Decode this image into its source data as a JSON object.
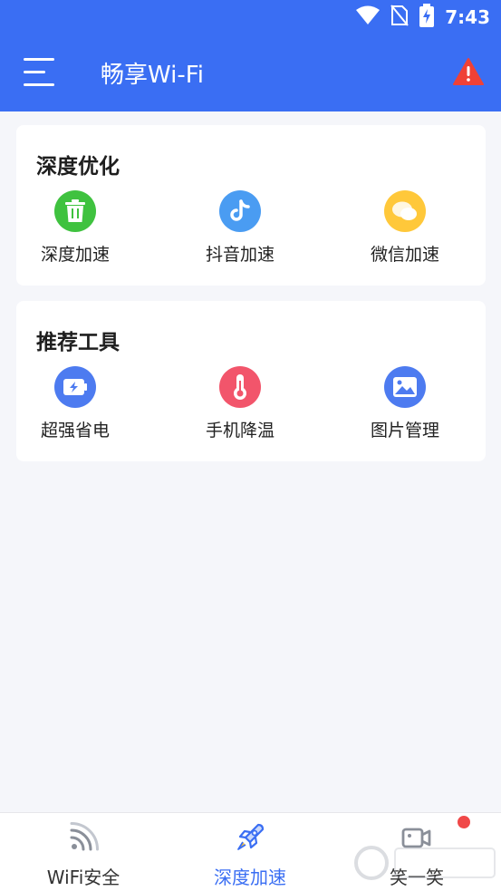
{
  "status_bar": {
    "time": "7:43",
    "icons": [
      "wifi-icon",
      "no-sim-icon",
      "battery-charging-icon"
    ]
  },
  "header": {
    "title": "畅享Wi-Fi",
    "menu_icon": "hamburger-menu-icon",
    "alert_icon": "warning-triangle-icon",
    "background_color": "#3a6ef3",
    "alert_color": "#ef4136"
  },
  "sections": [
    {
      "title": "深度优化",
      "items": [
        {
          "label": "深度加速",
          "icon": "trash-icon",
          "color": "#3fc23f"
        },
        {
          "label": "抖音加速",
          "icon": "tiktok-icon",
          "color": "#4a9cf2"
        },
        {
          "label": "微信加速",
          "icon": "wechat-icon",
          "color": "#ffc83a"
        }
      ]
    },
    {
      "title": "推荐工具",
      "items": [
        {
          "label": "超强省电",
          "icon": "battery-saver-icon",
          "color": "#4d7bf0"
        },
        {
          "label": "手机降温",
          "icon": "thermometer-icon",
          "color": "#f2556b"
        },
        {
          "label": "图片管理",
          "icon": "image-icon",
          "color": "#4d7bf0"
        }
      ]
    }
  ],
  "bottom_nav": {
    "items": [
      {
        "label": "WiFi安全",
        "icon": "wifi-signal-icon",
        "active": false
      },
      {
        "label": "深度加速",
        "icon": "rocket-icon",
        "active": true
      },
      {
        "label": "笑一笑",
        "icon": "video-icon",
        "active": false
      }
    ],
    "active_color": "#3a6ef3"
  }
}
